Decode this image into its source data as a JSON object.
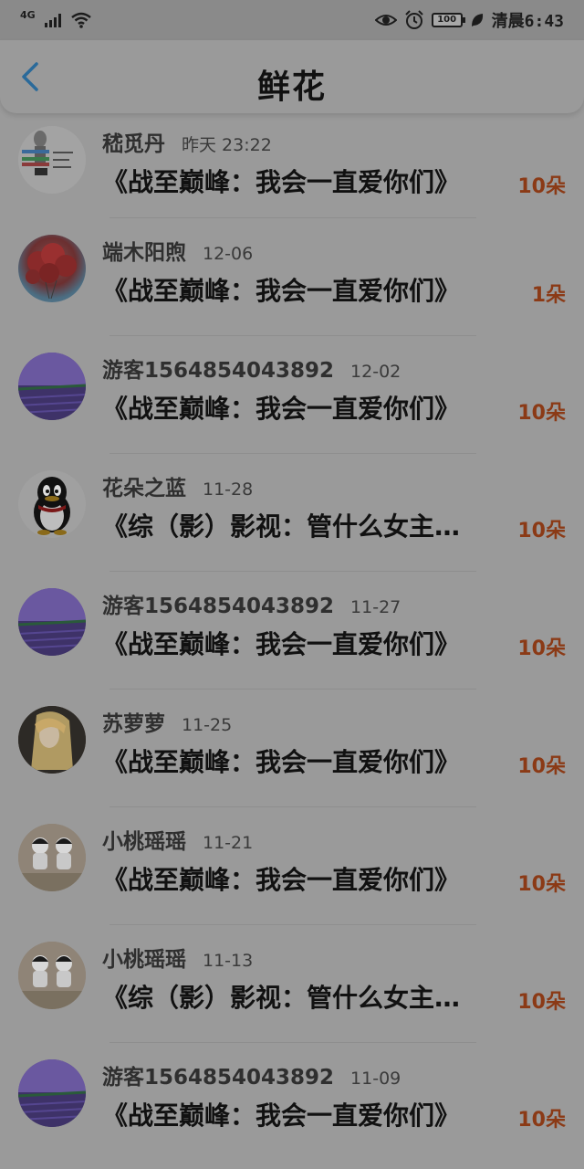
{
  "status_bar": {
    "network": "4G",
    "battery": "100",
    "time_label": "清晨6:43"
  },
  "header": {
    "title": "鲜花",
    "back_icon": "chevron-left-icon",
    "accent_color": "#2a6a9a"
  },
  "items": [
    {
      "name": "嵇觅丹",
      "date": "昨天 23:22",
      "content": "《战至巅峰：我会一直爱你们》",
      "count": "10朵",
      "avatar": "sketch"
    },
    {
      "name": "端木阳煦",
      "date": "12-06",
      "content": "《战至巅峰：我会一直爱你们》",
      "count": "1朵",
      "avatar": "balloons"
    },
    {
      "name": "游客1564854043892",
      "date": "12-02",
      "content": "《战至巅峰：我会一直爱你们》",
      "count": "10朵",
      "avatar": "lavender"
    },
    {
      "name": "花朵之蓝",
      "date": "11-28",
      "content": "《综（影）影视：管什么女主…",
      "count": "10朵",
      "avatar": "qq-penguin"
    },
    {
      "name": "游客1564854043892",
      "date": "11-27",
      "content": "《战至巅峰：我会一直爱你们》",
      "count": "10朵",
      "avatar": "lavender"
    },
    {
      "name": "苏萝萝",
      "date": "11-25",
      "content": "《战至巅峰：我会一直爱你们》",
      "count": "10朵",
      "avatar": "blonde-girl"
    },
    {
      "name": "小桃瑶瑶",
      "date": "11-21",
      "content": "《战至巅峰：我会一直爱你们》",
      "count": "10朵",
      "avatar": "dolls"
    },
    {
      "name": "小桃瑶瑶",
      "date": "11-13",
      "content": "《综（影）影视：管什么女主…",
      "count": "10朵",
      "avatar": "dolls"
    },
    {
      "name": "游客1564854043892",
      "date": "11-09",
      "content": "《战至巅峰：我会一直爱你们》",
      "count": "10朵",
      "avatar": "lavender"
    }
  ]
}
